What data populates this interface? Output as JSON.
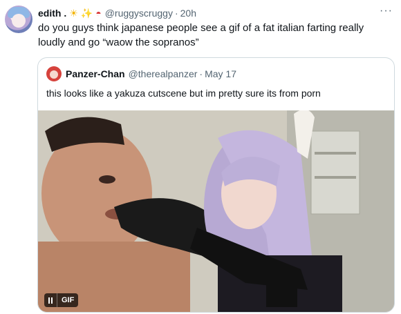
{
  "tweet": {
    "name": "edith .",
    "emojis": [
      "☀",
      "✨",
      "◓"
    ],
    "handle": "@ruggyscruggy",
    "separator": "·",
    "time": "20h",
    "more": "···",
    "text": "do you guys think japanese people see a gif of a fat italian farting really loudly and go “waow the sopranos”"
  },
  "quote": {
    "name": "Panzer-Chan",
    "handle": "@therealpanzer",
    "separator": "·",
    "date": "May 17",
    "text": "this looks like a yakuza cutscene but im pretty sure its from porn"
  },
  "media": {
    "badge": "GIF"
  }
}
